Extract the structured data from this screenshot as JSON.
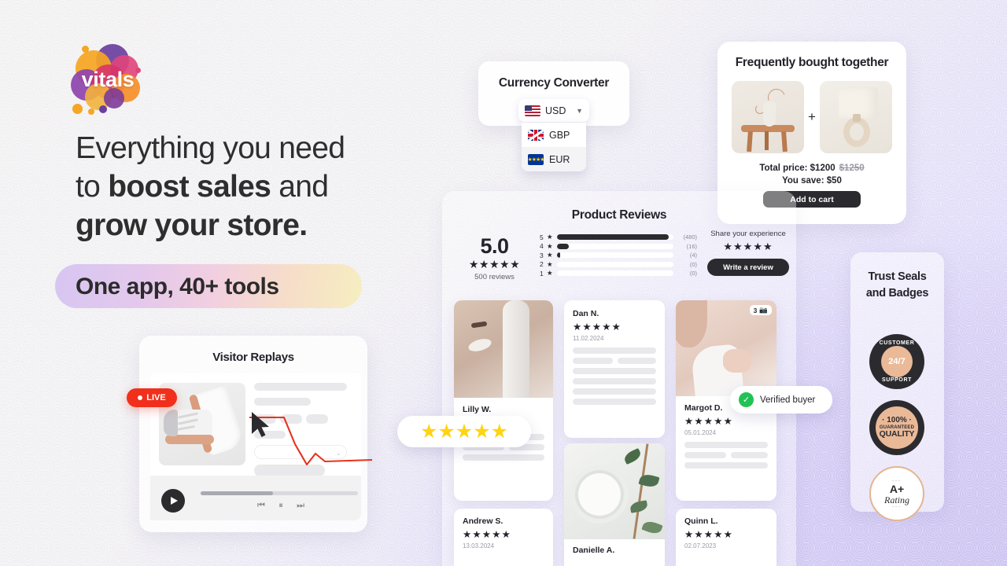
{
  "brand": {
    "name": "vitals"
  },
  "hero": {
    "line1": "Everything you need",
    "line2_pre": "to ",
    "line2_bold": "boost sales",
    "line2_post": " and",
    "line3_bold": "grow your store.",
    "pill": "One app, 40+ tools"
  },
  "currency": {
    "title": "Currency Converter",
    "selected": {
      "code": "USD",
      "flag": "us-flag-icon"
    },
    "chevron": "chevron-down-icon",
    "options": [
      {
        "code": "GBP",
        "flag": "gb-flag-icon"
      },
      {
        "code": "EUR",
        "flag": "eu-flag-icon"
      }
    ]
  },
  "fbt": {
    "title": "Frequently bought together",
    "plus": "+",
    "product_1": "side-table-vase-image",
    "product_2": "table-lamp-image",
    "total_label": "Total price: $1200",
    "total_old": "$1250",
    "save_label": "You save: $50",
    "cta": "Add to cart"
  },
  "reviews": {
    "title": "Product Reviews",
    "average": "5.0",
    "average_stars": "★★★★★",
    "count_label": "500 reviews",
    "breakdown": [
      {
        "stars": "5",
        "star_icon": "★",
        "count": "(480)",
        "pct": 96
      },
      {
        "stars": "4",
        "star_icon": "★",
        "count": "(16)",
        "pct": 10
      },
      {
        "stars": "3",
        "star_icon": "★",
        "count": "(4)",
        "pct": 3
      },
      {
        "stars": "2",
        "star_icon": "★",
        "count": "(0)",
        "pct": 0
      },
      {
        "stars": "1",
        "star_icon": "★",
        "count": "(0)",
        "pct": 0
      }
    ],
    "share_label": "Share your experience",
    "share_stars": "★★★★★",
    "write_cta": "Write a review",
    "verified_badge": "Verified buyer",
    "verified_check": "check-icon",
    "photo_badge_count": "3",
    "photo_badge_icon": "camera-icon",
    "floating_stars": "★★★★★",
    "items": [
      {
        "name": "Lilly W.",
        "stars": "★★★★★",
        "date": "",
        "photo": "woman-face-cream-image"
      },
      {
        "name": "Dan N.",
        "stars": "★★★★★",
        "date": "11.02.2024",
        "photo": ""
      },
      {
        "name": "Margot D.",
        "stars": "★★★★★",
        "date": "05.01.2024",
        "photo": "woman-shoulder-cream-image"
      },
      {
        "name": "Andrew S.",
        "stars": "★★★★★",
        "date": "13.03.2024",
        "photo": ""
      },
      {
        "name": "Danielle A.",
        "stars": "",
        "date": "",
        "photo": "cream-jar-eucalyptus-image"
      },
      {
        "name": "Quinn L.",
        "stars": "★★★★★",
        "date": "02.07.2023",
        "photo": ""
      }
    ]
  },
  "trust": {
    "title_line1": "Trust Seals",
    "title_line2": "and Badges",
    "seals": [
      {
        "id": "customer-support-seal",
        "top": "CUSTOMER",
        "center": "24/7",
        "bottom": "SUPPORT"
      },
      {
        "id": "quality-guarantee-seal",
        "l1": "· 100% ·",
        "l2": "GUARANTEED",
        "l3": "QUALITY"
      },
      {
        "id": "a-plus-rating-seal",
        "l1": "A+",
        "l2": "Rating",
        "dots": "···"
      }
    ]
  },
  "replays": {
    "title": "Visitor Replays",
    "live_label": "LIVE",
    "play_icon": "play-icon",
    "prev_icon": "⏮",
    "pause_icon": "⏸",
    "next_icon": "⏭",
    "shoe_image": "sneaker-product-image",
    "cursor_icon": "cursor-arrow-icon"
  },
  "colors": {
    "accent_red": "#f0301c",
    "dark": "#2b2b2f",
    "star_yellow": "#ffd414",
    "verified_green": "#21c254",
    "seal_tan": "#eab998",
    "bg_purple": "#d4ccf4"
  }
}
